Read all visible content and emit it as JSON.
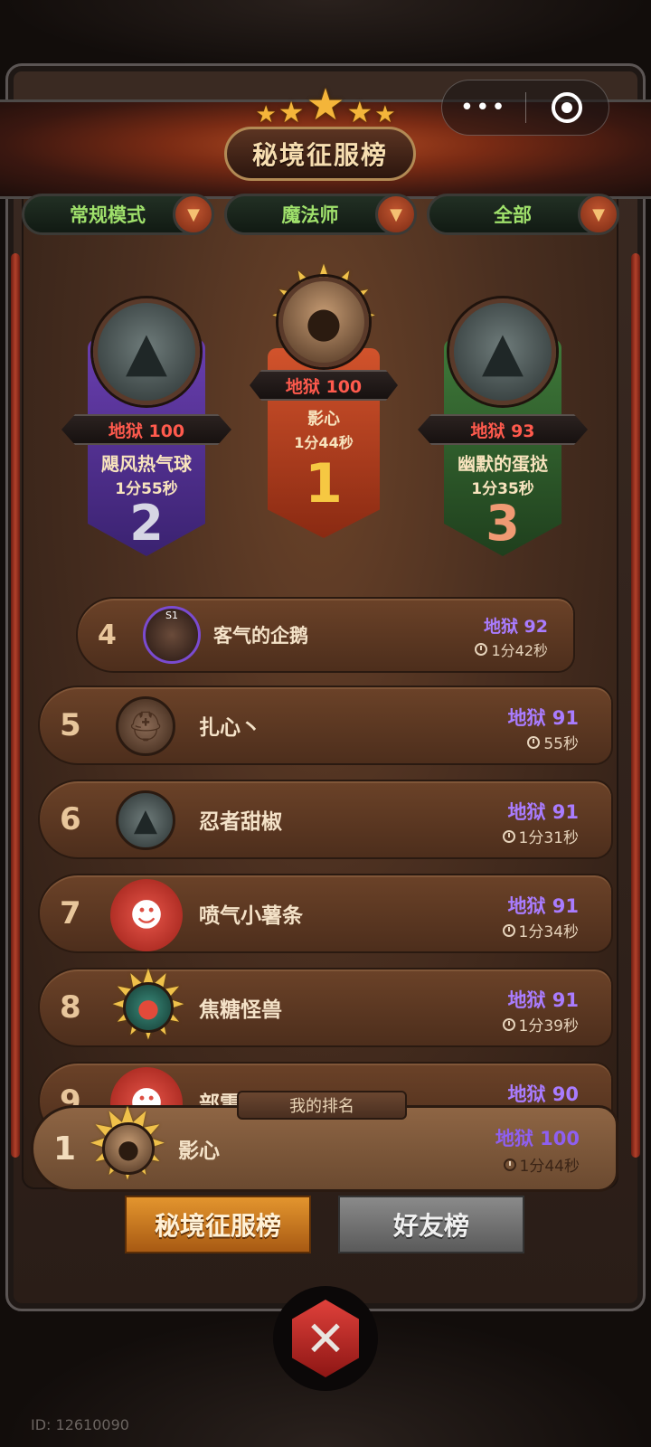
{
  "title": "秘境征服榜",
  "capsule": {
    "more": "•••"
  },
  "filters": [
    {
      "label": "常规模式"
    },
    {
      "label": "魔法师"
    },
    {
      "label": "全部"
    }
  ],
  "podium": [
    {
      "rank": "2",
      "difficulty": "地狱 100",
      "name": "飓风热气球",
      "time": "1分55秒"
    },
    {
      "rank": "1",
      "difficulty": "地狱 100",
      "name": "影心",
      "time": "1分44秒"
    },
    {
      "rank": "3",
      "difficulty": "地狱 93",
      "name": "幽默的蛋挞",
      "time": "1分35秒"
    }
  ],
  "list": [
    {
      "rank": "4",
      "name": "客气的企鹅",
      "difficulty": "地狱 92",
      "time": "1分42秒",
      "badge": "S1"
    },
    {
      "rank": "5",
      "name": "扎心丶",
      "difficulty": "地狱 91",
      "time": "55秒"
    },
    {
      "rank": "6",
      "name": "忍者甜椒",
      "difficulty": "地狱 91",
      "time": "1分31秒"
    },
    {
      "rank": "7",
      "name": "喷气小薯条",
      "difficulty": "地狱 91",
      "time": "1分34秒"
    },
    {
      "rank": "8",
      "name": "焦糖怪兽",
      "difficulty": "地狱 91",
      "time": "1分39秒"
    },
    {
      "rank": "9",
      "name": "部雷",
      "difficulty": "地狱 90",
      "time": ""
    }
  ],
  "my_rank": {
    "tag": "我的排名",
    "rank": "1",
    "name": "影心",
    "difficulty": "地狱 100",
    "time": "1分44秒"
  },
  "tabs": {
    "active": "秘境征服榜",
    "inactive": "好友榜"
  },
  "footer": {
    "id_text": "ID: 12610090"
  },
  "colors": {
    "difficulty_red": "#ff5a4d",
    "difficulty_purple": "#a97cff",
    "filter_green": "#9fe06b",
    "tab_active": "#e3952e",
    "tab_inactive": "#8a8a8a"
  }
}
